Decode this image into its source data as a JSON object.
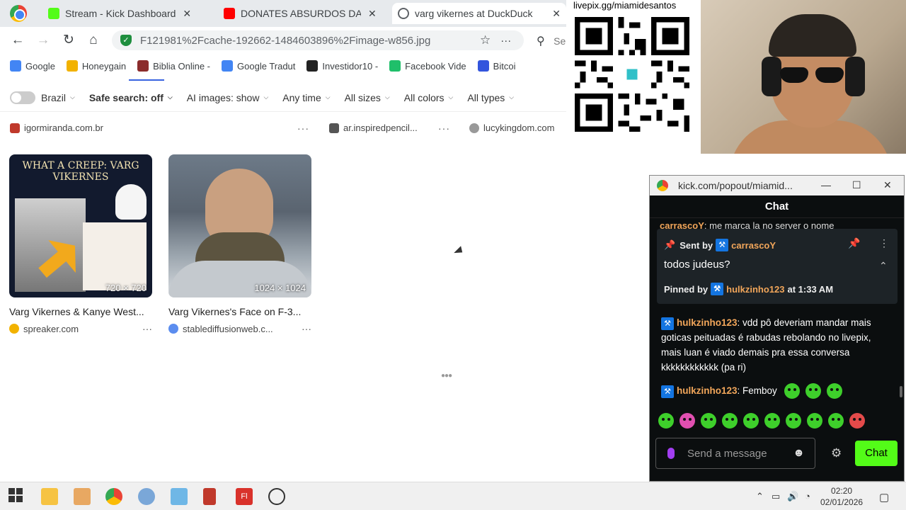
{
  "browser": {
    "tabs": [
      {
        "label": "Stream - Kick Dashboard",
        "color": "#53fc18"
      },
      {
        "label": "DONATES ABSURDOS DA ",
        "color": "#ff0000"
      },
      {
        "label": "varg vikernes at DuckDuck",
        "color": "#5f6368"
      }
    ],
    "url": "F121981%2Fcache-192662-1484603896%2Fimage-w856.jpg",
    "search_partial": "Se",
    "bookmarks": [
      {
        "label": "Google",
        "color": "#4285f4"
      },
      {
        "label": "Honeygain",
        "color": "#f2b200"
      },
      {
        "label": "Biblia Online -",
        "color": "#8b2c2c"
      },
      {
        "label": "Google Tradut",
        "color": "#4285f4"
      },
      {
        "label": "Investidor10 -",
        "color": "#222222"
      },
      {
        "label": "Facebook Vide",
        "color": "#1877f2"
      },
      {
        "label": "Bitcoi",
        "color": "#3355dd"
      }
    ]
  },
  "filters": {
    "region": "Brazil",
    "safe_search": "Safe search: off",
    "ai_images": "AI images: show",
    "time": "Any time",
    "sizes": "All sizes",
    "colors": "All colors",
    "types": "All types"
  },
  "sources": {
    "s1": "igormiranda.com.br",
    "s2": "ar.inspiredpencil...",
    "s3": "lucykingdom.com"
  },
  "results": [
    {
      "title": "Varg Vikernes & Kanye West...",
      "dims": "720 × 720",
      "source": "spreaker.com",
      "thumb_text": "WHAT A CREEP: VARG VIKERNES"
    },
    {
      "title": "Varg Vikernes's Face on F-3...",
      "dims": "1024 × 1024",
      "source": "stablediffusionweb.c..."
    }
  ],
  "overlay": {
    "qr_label": "livepix.gg/miamidesantos"
  },
  "chat": {
    "window_title": "kick.com/popout/miamid...",
    "header": "Chat",
    "partial_user": "carrascoY",
    "partial_text": "me marca la no server o nome",
    "pinned": {
      "sent_by_label": "Sent by",
      "sender": "carrascoY",
      "message": "todos judeus?",
      "pinned_by_label": "Pinned by",
      "pinned_by": "hulkzinho123",
      "time": "at 1:33 AM"
    },
    "messages": [
      {
        "user": "hulkzinho123",
        "text": "vdd pô deveriam mandar mais goticas peituadas é rabudas rebolando no livepix, mais luan é viado demais pra essa conversa kkkkkkkkkkkk (pa ri)"
      },
      {
        "user": "hulkzinho123",
        "text": "Femboy"
      }
    ],
    "input_placeholder": "Send a message",
    "send_label": "Chat",
    "accent": "#53fc18"
  },
  "taskbar": {
    "time": "02:20",
    "date": "02/01/2026"
  }
}
